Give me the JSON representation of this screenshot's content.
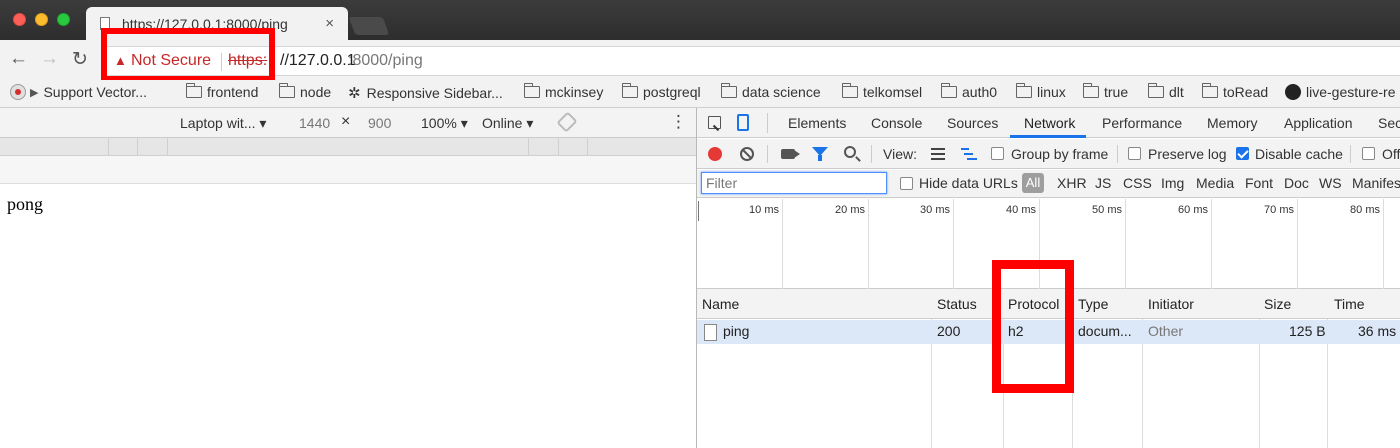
{
  "browser": {
    "tab_title": "https://127.0.0.1:8000/ping",
    "tab_close": "×",
    "security_label": "Not Secure",
    "url_scheme": "https:",
    "url_host": "//127.0.0.1",
    "url_path": ":8000/ping"
  },
  "bookmarks": [
    {
      "label": "Support Vector...",
      "icon": "record-icon"
    },
    {
      "label": "frontend",
      "icon": "folder-icon"
    },
    {
      "label": "node",
      "icon": "folder-icon"
    },
    {
      "label": "Responsive Sidebar...",
      "icon": "gear-icon"
    },
    {
      "label": "mckinsey",
      "icon": "folder-icon"
    },
    {
      "label": "postgreql",
      "icon": "folder-icon"
    },
    {
      "label": "data science",
      "icon": "folder-icon"
    },
    {
      "label": "telkomsel",
      "icon": "folder-icon"
    },
    {
      "label": "auth0",
      "icon": "folder-icon"
    },
    {
      "label": "linux",
      "icon": "folder-icon"
    },
    {
      "label": "true",
      "icon": "folder-icon"
    },
    {
      "label": "dlt",
      "icon": "folder-icon"
    },
    {
      "label": "toRead",
      "icon": "folder-icon"
    },
    {
      "label": "live-gesture-re",
      "icon": "github-icon"
    }
  ],
  "device_toolbar": {
    "device": "Laptop wit... ▾",
    "width": "1440",
    "times": "×",
    "height": "900",
    "zoom": "100% ▾",
    "throttle": "Online ▾",
    "kebab": "⋮"
  },
  "page": {
    "body_text": "pong"
  },
  "devtools": {
    "tabs": [
      "Elements",
      "Console",
      "Sources",
      "Network",
      "Performance",
      "Memory",
      "Application",
      "Sec"
    ],
    "active_tab": "Network",
    "toolbar": {
      "view_label": "View:",
      "group_by_frame": "Group by frame",
      "preserve_log": "Preserve log",
      "disable_cache": "Disable cache",
      "offline": "Off",
      "disable_cache_checked": true
    },
    "filter": {
      "placeholder": "Filter",
      "hide_data_urls": "Hide data URLs",
      "types": [
        "All",
        "XHR",
        "JS",
        "CSS",
        "Img",
        "Media",
        "Font",
        "Doc",
        "WS",
        "Manifes"
      ]
    },
    "timeline_labels": [
      "10 ms",
      "20 ms",
      "30 ms",
      "40 ms",
      "50 ms",
      "60 ms",
      "70 ms",
      "80 ms"
    ],
    "table": {
      "columns": [
        "Name",
        "Status",
        "Protocol",
        "Type",
        "Initiator",
        "Size",
        "Time"
      ],
      "rows": [
        {
          "name": "ping",
          "status": "200",
          "protocol": "h2",
          "type": "docum...",
          "initiator": "Other",
          "size": "125 B",
          "time": "36 ms"
        }
      ]
    }
  },
  "colors": {
    "highlight": "#ff0000",
    "insecure": "#c62828",
    "accent": "#1a73e8"
  }
}
